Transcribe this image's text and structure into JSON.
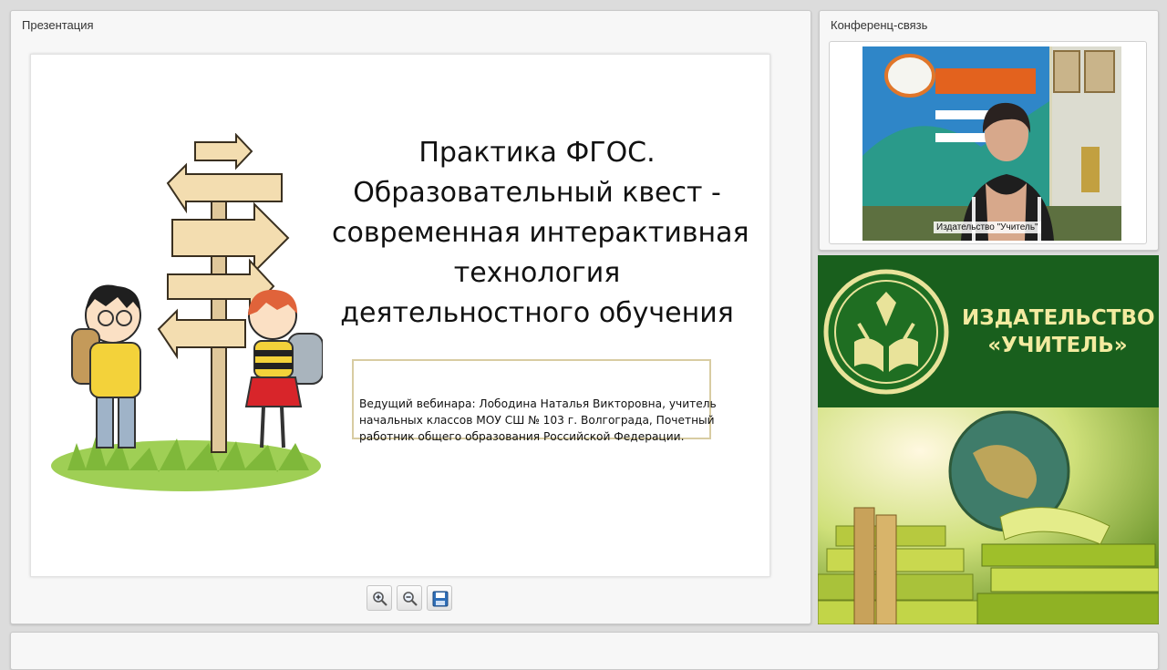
{
  "presentation": {
    "panel_title": "Презентация",
    "slide": {
      "title_lines": [
        "Практика ФГОС.",
        "Образовательный квест -",
        "современная интерактивная",
        "технология",
        "деятельностного обучения"
      ],
      "speaker_lines": [
        "Ведущий вебинара:  Лободина Наталья Викторовна, учитель",
        "начальных классов МОУ СШ № 103 г. Волгограда, Почетный",
        "работник общего образования Российской Федерации."
      ]
    },
    "toolbar": {
      "buttons": [
        {
          "name": "zoom-in",
          "icon": "zoom-in-icon"
        },
        {
          "name": "zoom-out",
          "icon": "zoom-out-icon"
        },
        {
          "name": "save",
          "icon": "floppy-disk-icon"
        }
      ]
    }
  },
  "conference": {
    "panel_title": "Конференц-связь",
    "video_caption": "Издательство \"Учитель\""
  },
  "publisher": {
    "name_line1": "ИЗДАТЕЛЬСТВО",
    "name_line2": "«УЧИТЕЛЬ»"
  },
  "colors": {
    "banner_green": "#195f1d",
    "banner_text": "#f3eba0",
    "speaker_border": "#d8cca2"
  }
}
